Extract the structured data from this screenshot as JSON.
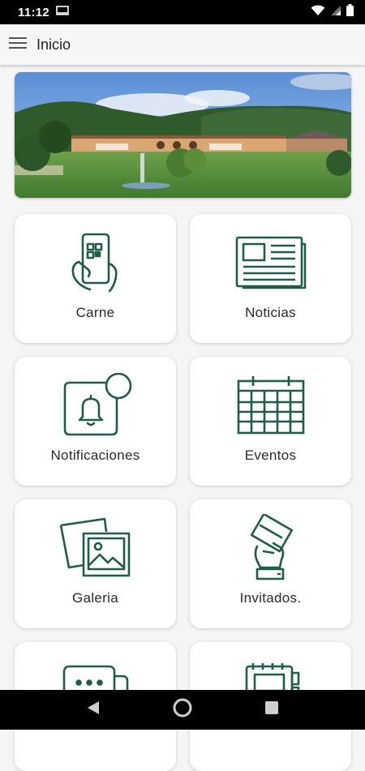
{
  "status_bar": {
    "time": "11:12",
    "icons": [
      "screen-icon",
      "wifi-icon",
      "signal-icon",
      "battery-icon"
    ]
  },
  "app_bar": {
    "title": "Inicio",
    "menu_icon": "hamburger-menu-icon"
  },
  "hero": {
    "image": "clubhouse-golf-course-photo"
  },
  "theme": {
    "accent": "#1f5c49",
    "card_bg": "#ffffff",
    "page_bg": "#f5f5f5"
  },
  "menu": [
    {
      "label": "Carne",
      "icon": "phone-qr-icon"
    },
    {
      "label": "Noticias",
      "icon": "newspaper-icon"
    },
    {
      "label": "Notificaciones",
      "icon": "notification-bell-icon"
    },
    {
      "label": "Eventos",
      "icon": "calendar-icon"
    },
    {
      "label": "Galeria",
      "icon": "photo-gallery-icon"
    },
    {
      "label": "Invitados.",
      "icon": "guest-card-hand-icon"
    },
    {
      "label": "",
      "icon": "chat-bubble-icon"
    },
    {
      "label": "",
      "icon": "notebook-icon"
    }
  ],
  "nav_bar": {
    "buttons": [
      "back-icon",
      "home-icon",
      "recents-icon"
    ]
  }
}
